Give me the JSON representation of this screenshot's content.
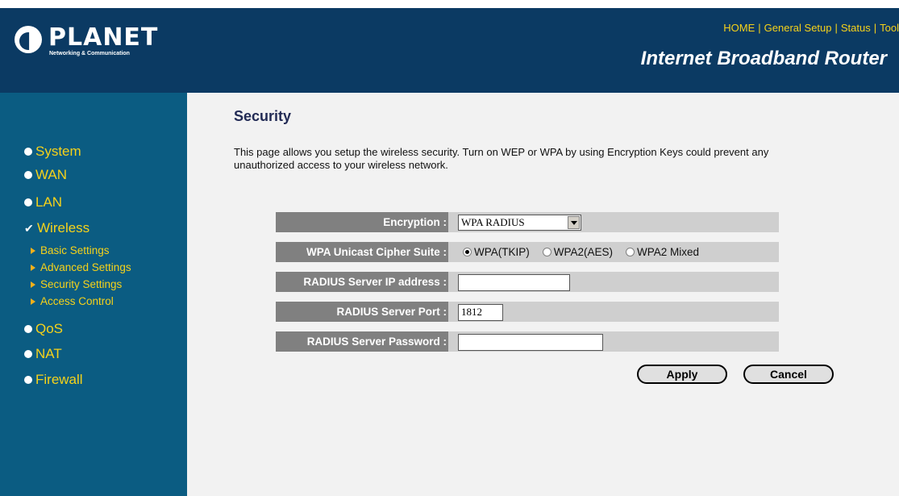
{
  "header": {
    "logo_name": "PLANET",
    "logo_sub": "Networking & Communication",
    "title": "Internet Broadband Router",
    "nav": [
      "HOME",
      "General Setup",
      "Status",
      "Tool"
    ]
  },
  "sidebar": {
    "items": [
      {
        "label": "System"
      },
      {
        "label": "WAN"
      },
      {
        "label": "LAN"
      },
      {
        "label": "Wireless",
        "active": true
      },
      {
        "label": "QoS"
      },
      {
        "label": "NAT"
      },
      {
        "label": "Firewall"
      }
    ],
    "sub_items": [
      "Basic Settings",
      "Advanced Settings",
      "Security Settings",
      "Access Control"
    ]
  },
  "main": {
    "title": "Security",
    "description": "This page allows you setup the wireless security. Turn on WEP or WPA by using Encryption Keys could prevent any unauthorized access to your wireless network.",
    "form": {
      "encryption_label": "Encryption :",
      "encryption_value": "WPA RADIUS",
      "cipher_label": "WPA Unicast Cipher Suite :",
      "cipher_options": [
        "WPA(TKIP)",
        "WPA2(AES)",
        "WPA2 Mixed"
      ],
      "cipher_selected": "WPA(TKIP)",
      "radius_ip_label": "RADIUS Server IP address :",
      "radius_ip_value": "",
      "radius_port_label": "RADIUS Server Port :",
      "radius_port_value": "1812",
      "radius_password_label": "RADIUS Server Password :",
      "radius_password_value": ""
    },
    "buttons": {
      "apply": "Apply",
      "cancel": "Cancel"
    }
  },
  "colors": {
    "header_bg": "#0b3a63",
    "sidebar_bg": "#0b5c82",
    "link_yellow": "#f6d21a",
    "label_gray": "#808080",
    "row_gray": "#cfcfcf"
  }
}
